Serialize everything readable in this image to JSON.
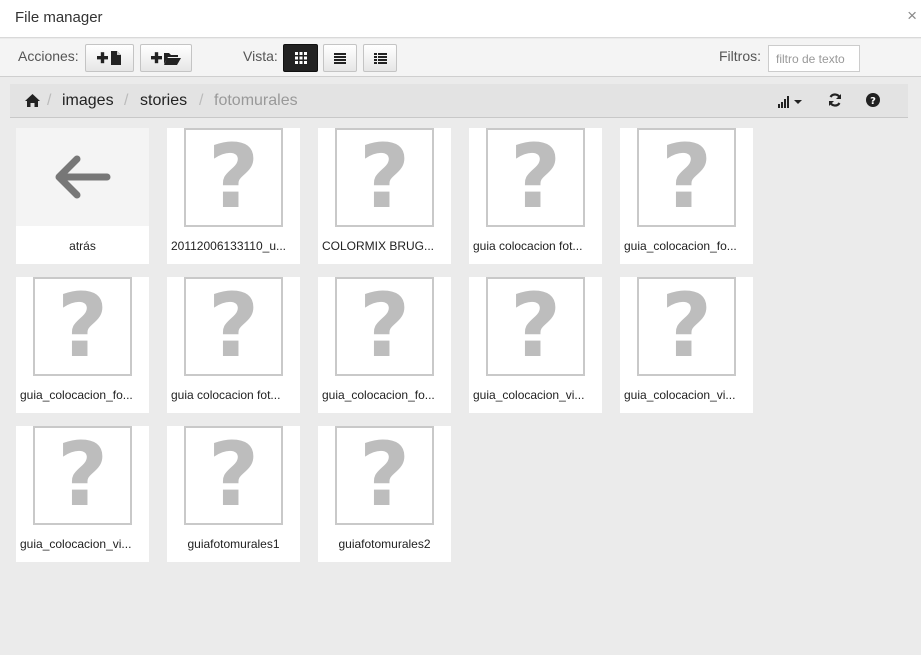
{
  "window": {
    "title": "File manager",
    "close_glyph": "×"
  },
  "toolbar": {
    "actions_label": "Acciones:",
    "view_label": "Vista:",
    "filters_label": "Filtros:",
    "filter_placeholder": "filtro de texto",
    "filter_value": "",
    "active_view": "thumbnails"
  },
  "breadcrumb": {
    "items": [
      "images",
      "stories",
      "fotomurales"
    ],
    "separator": "/"
  },
  "files": [
    {
      "label": "atrás",
      "type": "back"
    },
    {
      "label": "20112006133110_u...",
      "type": "file"
    },
    {
      "label": "COLORMIX BRUG...",
      "type": "file"
    },
    {
      "label": "guia colocacion fot...",
      "type": "file"
    },
    {
      "label": "guia_colocacion_fo...",
      "type": "file"
    },
    {
      "label": "guia_colocacion_fo...",
      "type": "file"
    },
    {
      "label": "guia colocacion fot...",
      "type": "file"
    },
    {
      "label": "guia_colocacion_fo...",
      "type": "file"
    },
    {
      "label": "guia_colocacion_vi...",
      "type": "file"
    },
    {
      "label": "guia_colocacion_vi...",
      "type": "file"
    },
    {
      "label": "guia_colocacion_vi...",
      "type": "file"
    },
    {
      "label": "guiafotomurales1",
      "type": "file"
    },
    {
      "label": "guiafotomurales2",
      "type": "file"
    }
  ],
  "icons": {
    "placeholder_glyph": "?",
    "colors": {
      "placeholder": "#bdbdbd",
      "active_button": "#222222",
      "panel_bg": "#ebebeb"
    }
  }
}
